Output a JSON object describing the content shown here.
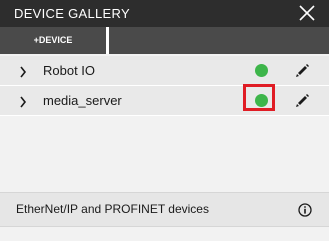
{
  "window": {
    "title": "DEVICE GALLERY",
    "close_icon": "close-icon"
  },
  "toolbar": {
    "add_device_label": "+DEVICE"
  },
  "devices": [
    {
      "name": "Robot IO",
      "status": "online",
      "status_color": "#3db54a",
      "highlighted": false
    },
    {
      "name": "media_server",
      "status": "online",
      "status_color": "#3db54a",
      "highlighted": true
    }
  ],
  "footer": {
    "text": "EtherNet/IP and PROFINET devices",
    "info_icon": "info-icon"
  },
  "colors": {
    "titlebar": "#2d2d2d",
    "toolbar": "#4a4a4a",
    "status_online": "#3db54a",
    "highlight": "#e01c24"
  }
}
